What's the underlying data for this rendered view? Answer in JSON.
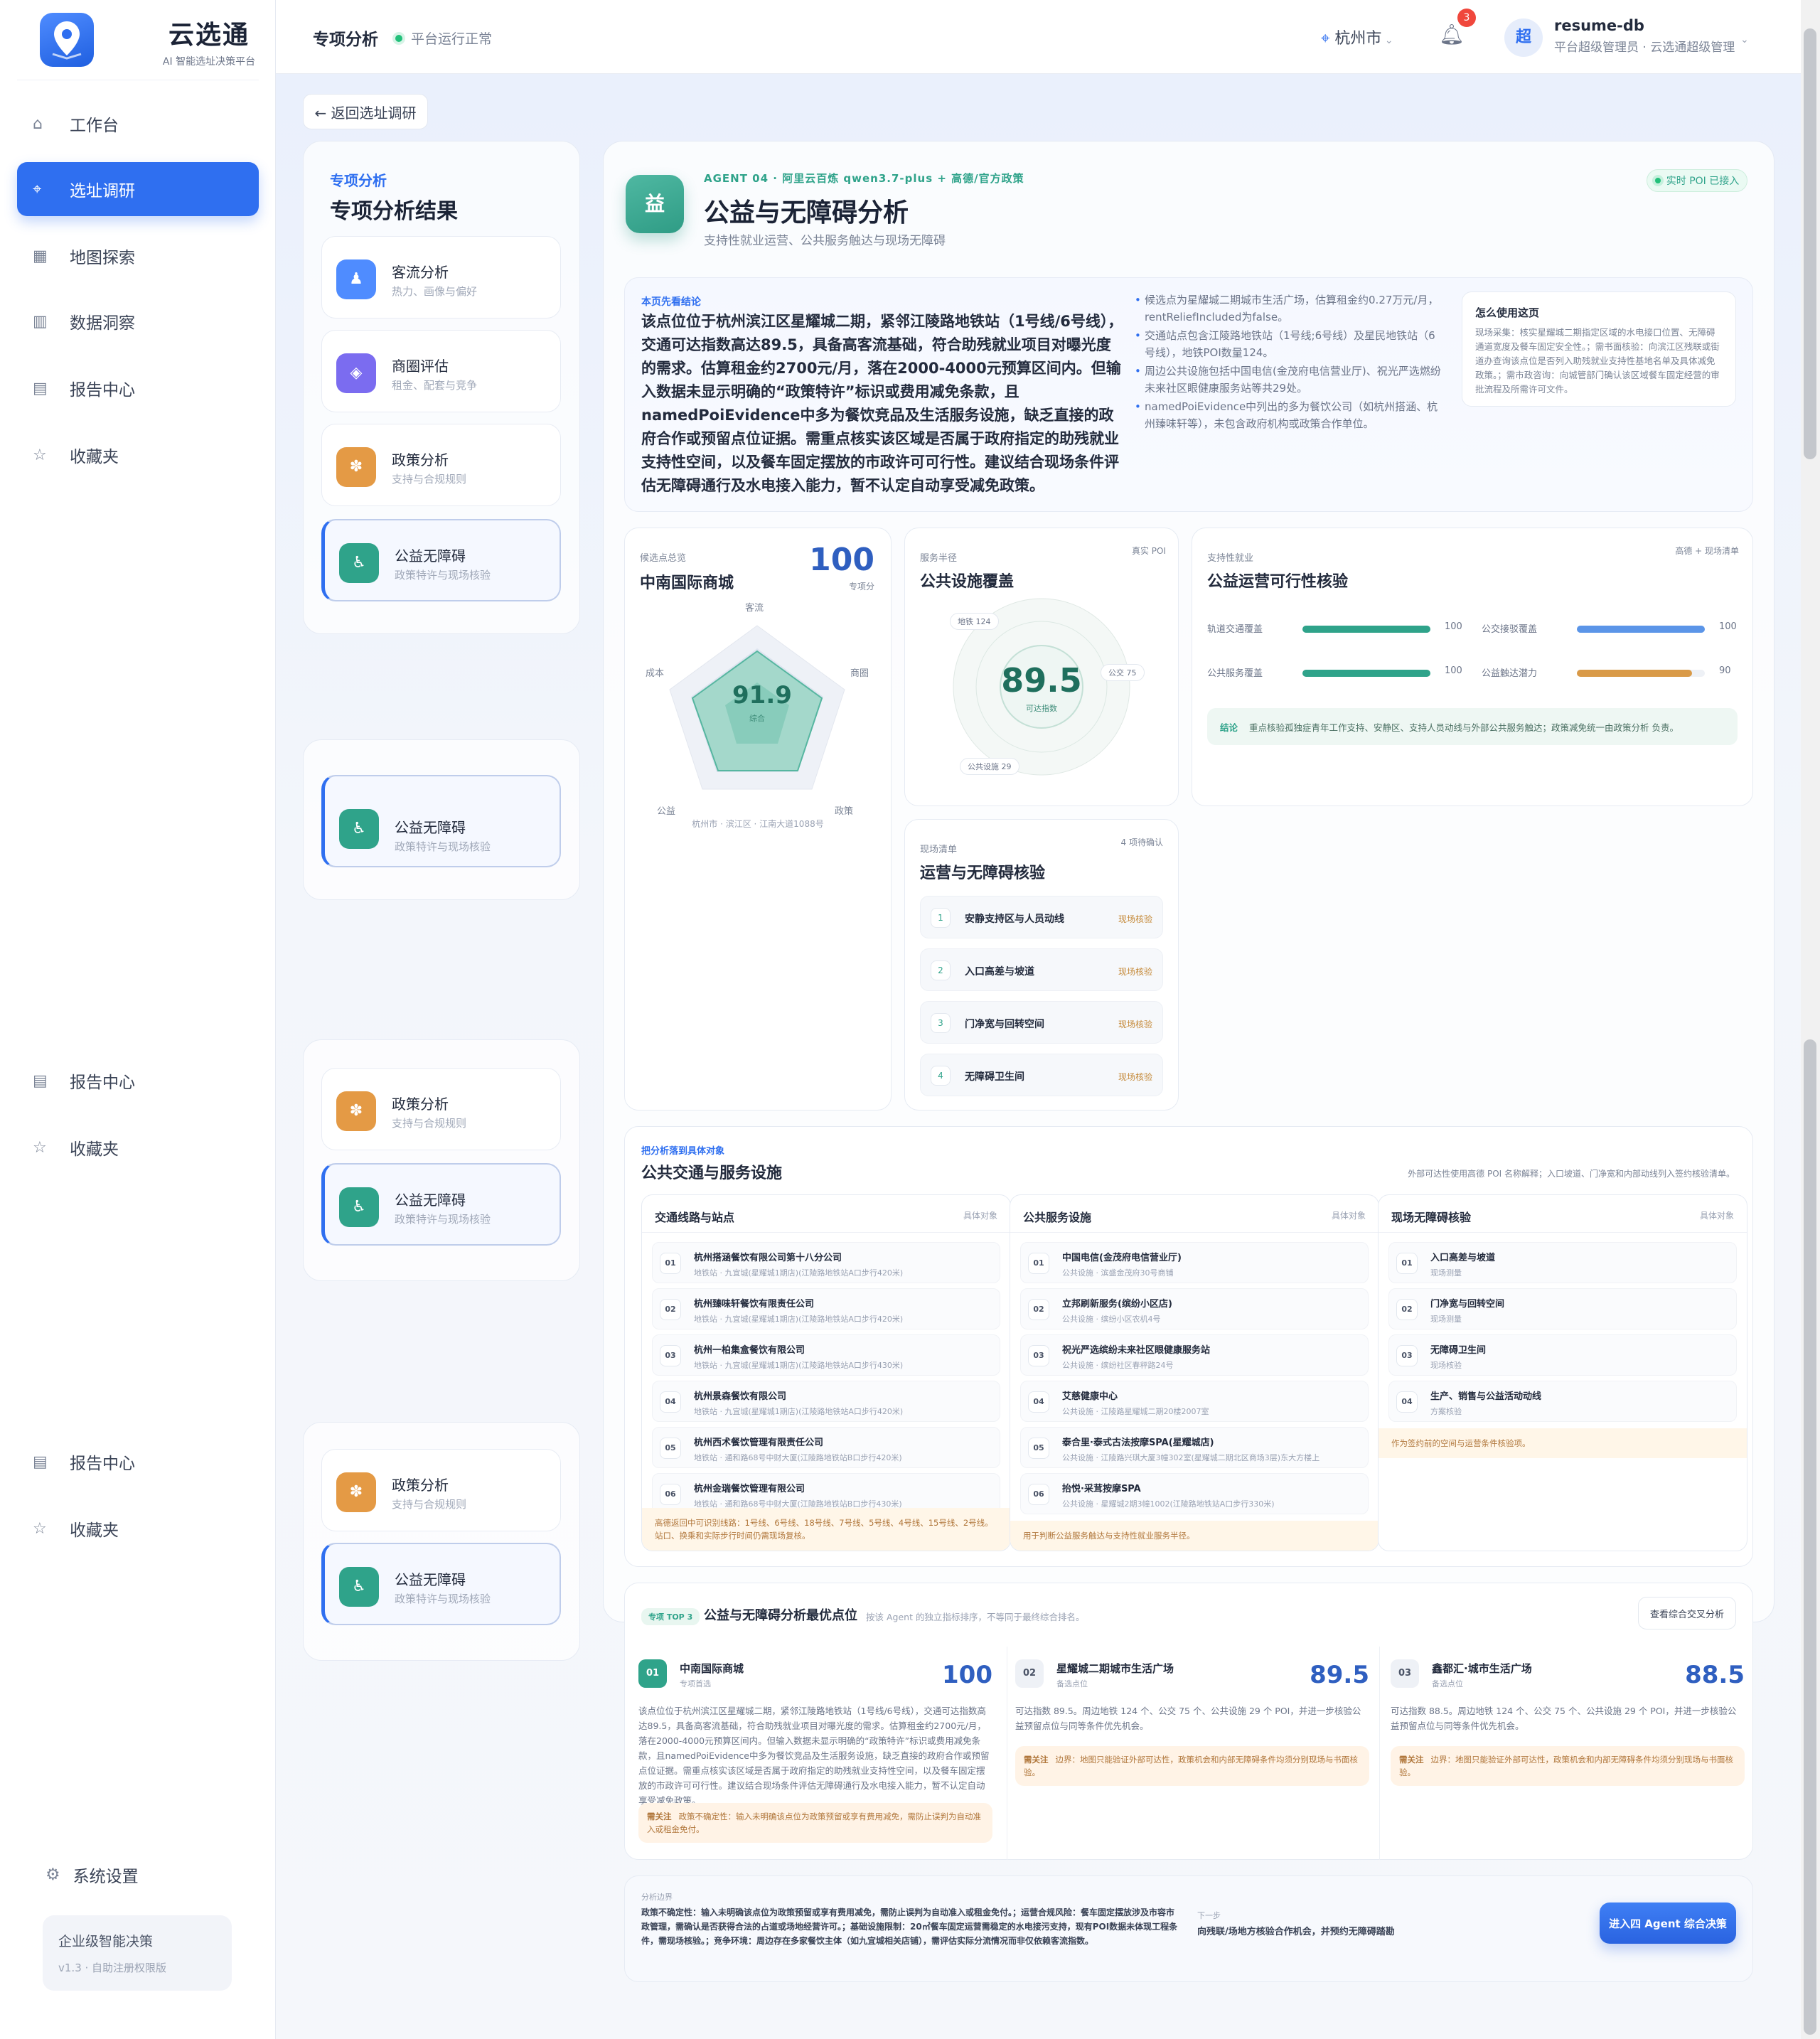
{
  "brand": {
    "title": "云选通",
    "subtitle": "AI 智能选址决策平台"
  },
  "nav": [
    {
      "label": "工作台",
      "icon": "home-icon"
    },
    {
      "label": "选址调研",
      "icon": "location-icon"
    },
    {
      "label": "地图探索",
      "icon": "map-icon"
    },
    {
      "label": "数据洞察",
      "icon": "chart-icon"
    },
    {
      "label": "报告中心",
      "icon": "report-icon"
    },
    {
      "label": "收藏夹",
      "icon": "star-icon"
    }
  ],
  "nav_repeat": [
    {
      "label": "报告中心"
    },
    {
      "label": "收藏夹"
    }
  ],
  "settings": {
    "label": "系统设置"
  },
  "plan": {
    "title": "企业级智能决策",
    "version": "v1.3 · 自助注册权限版"
  },
  "topbar": {
    "title": "专项分析",
    "status": "平台运行正常",
    "city": "杭州市",
    "notifications": "3",
    "avatar": "超",
    "user": "resume-db",
    "role": "平台超级管理员 · 云选通超级管理"
  },
  "back": "← 返回选址调研",
  "left": {
    "kicker": "专项分析",
    "title": "专项分析结果",
    "items": [
      {
        "name": "客流分析",
        "sub": "热力、画像与偏好",
        "color": "#4f8cff",
        "icon": "person-icon",
        "glyph": "♟"
      },
      {
        "name": "商圈评估",
        "sub": "租金、配套与竞争",
        "color": "#7b6cf0",
        "icon": "diamond-icon",
        "glyph": "◈"
      },
      {
        "name": "政策分析",
        "sub": "支持与合规规则",
        "color": "#e49a45",
        "icon": "flower-icon",
        "glyph": "✽"
      },
      {
        "name": "公益无障碍",
        "sub": "政策特许与现场核验",
        "color": "#2fa38a",
        "icon": "wheelchair-icon",
        "glyph": "♿"
      }
    ]
  },
  "agent": {
    "kicker": "AGENT 04 · 阿里云百炼 qwen3.7-plus + 高德/官方政策",
    "title": "公益与无障碍分析",
    "subtitle": "支持性就业运营、公共服务触达与现场无障碍",
    "badge": "实时 POI 已接入",
    "icon_text": "益"
  },
  "summary": {
    "kicker": "本页先看结论",
    "text": "该点位位于杭州滨江区星耀城二期，紧邻江陵路地铁站（1号线/6号线），交通可达指数高达89.5，具备高客流基础，符合助残就业项目对曝光度的需求。估算租金约2700元/月，落在2000-4000元预算区间内。但输入数据未显示明确的“政策特许”标识或费用减免条款，且namedPoiEvidence中多为餐饮竞品及生活服务设施，缺乏直接的政府合作或预留点位证据。需重点核实该区域是否属于政府指定的助残就业支持性空间，以及餐车固定摆放的市政许可可行性。建议结合现场条件评估无障碍通行及水电接入能力，暂不认定自动享受减免政策。",
    "bullets": [
      "候选点为星耀城二期城市生活广场，估算租金约0.27万元/月，rentReliefIncluded为false。",
      "交通站点包含江陵路地铁站（1号线;6号线）及星民地铁站（6号线），地铁POI数量124。",
      "周边公共设施包括中国电信(金茂府电信营业厅)、祝光严选燃纷未来社区眼健康服务站等共29处。",
      "namedPoiEvidence中列出的多为餐饮公司（如杭州搭涵、杭州臻味轩等），未包含政府机构或政策合作单位。"
    ],
    "howto_title": "怎么使用这页",
    "howto_body": "现场采集：核实星耀城二期指定区域的水电接口位置、无障碍通道宽度及餐车固定安全性。；需书面核验：向滨江区残联或街道办查询该点位是否列入助残就业支持性基地名单及具体减免政策。；需市政咨询：向城管部门确认该区域餐车固定经营的审批流程及所需许可文件。"
  },
  "score_card": {
    "kicker": "候选点总览",
    "name": "中南国际商城",
    "score": "100",
    "score_label": "专项分",
    "center": "91.9",
    "center_label": "综合",
    "axes": [
      "客流",
      "商圈",
      "政策",
      "公益",
      "成本"
    ],
    "address": "杭州市 · 滨江区 · 江南大道1088号"
  },
  "coverage": {
    "kicker": "服务半径",
    "title": "公共设施覆盖",
    "tag": "真实 POI",
    "value": "89.5",
    "value_label": "可达指数",
    "labels": [
      "地铁 124",
      "公交 75",
      "公共设施 29"
    ]
  },
  "feasibility": {
    "kicker": "支持性就业",
    "title": "公益运营可行性核验",
    "tag": "高德 + 现场清单",
    "bars": [
      {
        "label": "轨道交通覆盖",
        "value": 100,
        "color": "#2fa38a"
      },
      {
        "label": "公交接驳覆盖",
        "value": 100,
        "color": "#5b95e8"
      },
      {
        "label": "公共服务覆盖",
        "value": 100,
        "color": "#2fa38a"
      },
      {
        "label": "公益触达潜力",
        "value": 90,
        "color": "#d99a48"
      }
    ],
    "conclusion_label": "结论",
    "conclusion": "重点核验孤独症青年工作支持、安静区、支持人员动线与外部公共服务触达；政策减免统一由政策分析 负责。"
  },
  "checklist": {
    "kicker": "现场清单",
    "title": "运营与无障碍核验",
    "tag": "4 项待确认",
    "items": [
      {
        "n": "1",
        "t": "安静支持区与人员动线",
        "s": "现场核验"
      },
      {
        "n": "2",
        "t": "入口高差与坡道",
        "s": "现场核验"
      },
      {
        "n": "3",
        "t": "门净宽与回转空间",
        "s": "现场核验"
      },
      {
        "n": "4",
        "t": "无障碍卫生间",
        "s": "现场核验"
      }
    ]
  },
  "facilities": {
    "kicker": "把分析落到具体对象",
    "title": "公共交通与服务设施",
    "note": "外部可达性使用高德 POI 名称解释；入口坡道、门净宽和内部动线列入签约核验清单。",
    "columns": [
      {
        "title": "交通线路与站点",
        "tag": "具体对象",
        "rows": [
          {
            "n": "01",
            "t": "杭州搭涵餐饮有限公司第十八分公司",
            "s": "地铁站 · 九宜城(星耀城1期店)(江陵路地铁站A口步行420米)"
          },
          {
            "n": "02",
            "t": "杭州臻味轩餐饮有限责任公司",
            "s": "地铁站 · 九宜城(星耀城1期店)(江陵路地铁站A口步行420米)"
          },
          {
            "n": "03",
            "t": "杭州一柏集盒餐饮有限公司",
            "s": "地铁站 · 九宜城(星耀城1期店)(江陵路地铁站A口步行430米)"
          },
          {
            "n": "04",
            "t": "杭州景森餐饮有限公司",
            "s": "地铁站 · 九宜城(星耀城1期店)(江陵路地铁站A口步行420米)"
          },
          {
            "n": "05",
            "t": "杭州西术餐饮管理有限责任公司",
            "s": "地铁站 · 通和路68号中财大厦(江陵路地铁站B口步行420米)"
          },
          {
            "n": "06",
            "t": "杭州金瑞餐饮管理有限公司",
            "s": "地铁站 · 通和路68号中财大厦(江陵路地铁站B口步行430米)"
          }
        ],
        "note": "高德返回中可识别线路：1号线、6号线、18号线、7号线、5号线、4号线、15号线、2号线。站口、换乘和实际步行时间仍需现场复核。"
      },
      {
        "title": "公共服务设施",
        "tag": "具体对象",
        "rows": [
          {
            "n": "01",
            "t": "中国电信(金茂府电信营业厅)",
            "s": "公共设施 · 滨盛金茂府30号商铺"
          },
          {
            "n": "02",
            "t": "立邦刷新服务(缤纷小区店)",
            "s": "公共设施 · 缤纷小区农机4号"
          },
          {
            "n": "03",
            "t": "祝光严选缤纷未来社区眼健康服务站",
            "s": "公共设施 · 缤纷社区春秤路24号"
          },
          {
            "n": "04",
            "t": "艾慈健康中心",
            "s": "公共设施 · 江陵路星耀城二期20楼2007室"
          },
          {
            "n": "05",
            "t": "泰合里·泰式古法按摩SPA(星耀城店)",
            "s": "公共设施 · 江陵路兴琪大厦3幢302室(星耀城二期北区商场3层)东大方楼上"
          },
          {
            "n": "06",
            "t": "抬悦·采茸按摩SPA",
            "s": "公共设施 · 星耀城2期3幢1002(江陵路地铁站A口步行330米)"
          }
        ],
        "note": "用于判断公益服务触达与支持性就业服务半径。"
      },
      {
        "title": "现场无障碍核验",
        "tag": "具体对象",
        "rows": [
          {
            "n": "01",
            "t": "入口高差与坡道",
            "s": "现场测量"
          },
          {
            "n": "02",
            "t": "门净宽与回转空间",
            "s": "现场测量"
          },
          {
            "n": "03",
            "t": "无障碍卫生间",
            "s": "现场核验"
          },
          {
            "n": "04",
            "t": "生产、销售与公益活动动线",
            "s": "方案核验"
          }
        ],
        "note": "作为签约前的空间与运营条件核验项。"
      }
    ]
  },
  "top3": {
    "tag": "专项 TOP 3",
    "title": "公益与无障碍分析最优点位",
    "desc": "按该 Agent 的独立指标排序，不等同于最终综合排名。",
    "button": "查看综合交叉分析",
    "items": [
      {
        "n": "01",
        "name": "中南国际商城",
        "sub": "专项首选",
        "score": "100",
        "desc": "该点位位于杭州滨江区星耀城二期，紧邻江陵路地铁站（1号线/6号线），交通可达指数高达89.5，具备高客流基础，符合助残就业项目对曝光度的需求。估算租金约2700元/月，落在2000-4000元预算区间内。但输入数据未显示明确的“政策特许”标识或费用减免条款，且namedPoiEvidence中多为餐饮竞品及生活服务设施，缺乏直接的政府合作或预留点位证据。需重点核实该区域是否属于政府指定的助残就业支持性空间，以及餐车固定摆放的市政许可可行性。建议结合现场条件评估无障碍通行及水电接入能力，暂不认定自动享受减免政策。",
        "warn_label": "需关注",
        "warn": "政策不确定性：输入未明确该点位为政策预留或享有费用减免，需防止误判为自动准入或租金免付。"
      },
      {
        "n": "02",
        "name": "星耀城二期城市生活广场",
        "sub": "备选点位",
        "score": "89.5",
        "desc": "可达指数 89.5。周边地铁 124 个、公交 75 个、公共设施 29 个 POI，并进一步核验公益预留点位与同等条件优先机会。",
        "warn_label": "需关注",
        "warn": "边界：地图只能验证外部可达性，政策机会和内部无障碍条件均须分别现场与书面核验。"
      },
      {
        "n": "03",
        "name": "鑫都汇·城市生活广场",
        "sub": "备选点位",
        "score": "88.5",
        "desc": "可达指数 88.5。周边地铁 124 个、公交 75 个、公共设施 29 个 POI，并进一步核验公益预留点位与同等条件优先机会。",
        "warn_label": "需关注",
        "warn": "边界：地图只能验证外部可达性，政策机会和内部无障碍条件均须分别现场与书面核验。"
      }
    ]
  },
  "footer": {
    "kicker": "分析边界",
    "text": "政策不确定性：输入未明确该点位为政策预留或享有费用减免，需防止误判为自动准入或租金免付。；运营合规风险：餐车固定摆放涉及市容市政管理，需确认是否获得合法的占道或场地经营许可。；基础设施限制：20㎡餐车固定运营需稳定的水电接污支持，现有POI数据未体现工程条件，需现场核验。；竞争环境：周边存在多家餐饮主体（如九宜城相关店铺），需评估实际分流情况而非仅依赖客流指数。",
    "next_kicker": "下一步",
    "next": "向残联/场地方核验合作机会，并预约无障碍踏勘",
    "cta": "进入四 Agent 综合决策"
  }
}
